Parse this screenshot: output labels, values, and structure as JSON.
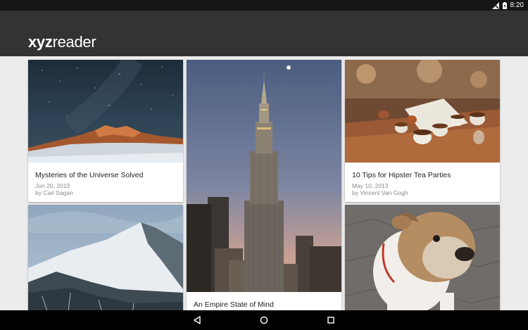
{
  "status_bar": {
    "time": "8:20"
  },
  "app": {
    "logo_bold": "xyz",
    "logo_light": "reader"
  },
  "articles": [
    {
      "title": "Mysteries of the Universe Solved",
      "date": "Jun 20, 2013",
      "author": "by Carl Sagan",
      "image": "night-sky-mountain-image"
    },
    {
      "title": "An Empire State of Mind",
      "date": "",
      "author": "",
      "image": "empire-state-building-image"
    },
    {
      "title": "10 Tips for Hipster Tea Parties",
      "date": "May 10, 2013",
      "author": "by Vincent Van Gogh",
      "image": "tea-cups-image"
    },
    {
      "title": "",
      "date": "",
      "author": "",
      "image": "snowy-mountain-image"
    },
    {
      "title": "",
      "date": "",
      "author": "",
      "image": "bulldog-image"
    }
  ],
  "colors": {
    "app_bar": "#333333",
    "status_bar": "#151515",
    "background": "#ececec",
    "nav_bar": "#000000"
  }
}
